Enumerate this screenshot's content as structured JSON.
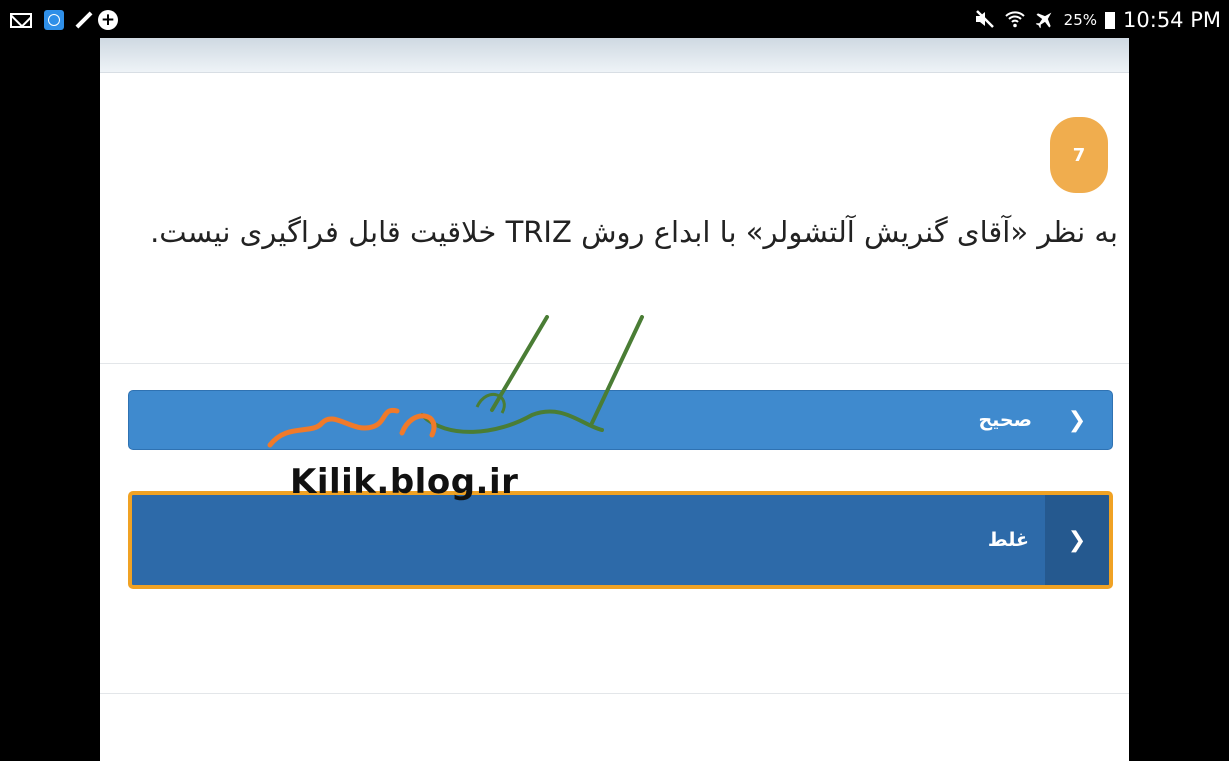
{
  "status_bar": {
    "left_icons": [
      "mail-icon",
      "app-icon",
      "pen-icon",
      "plus-icon"
    ],
    "right_icons": [
      "mute-icon",
      "wifi-icon",
      "airplane-icon",
      "battery-icon"
    ],
    "battery": "25%",
    "time": "10:54 PM"
  },
  "question": {
    "number": "7",
    "text": "به نظر «آقای گنریش آلتشولر» با ابداع روش TRIZ خلاقیت قابل فراگیری نیست."
  },
  "options": [
    {
      "label": "صحیح",
      "icon": "chevron-left-icon",
      "selected": false
    },
    {
      "label": "غلط",
      "icon": "chevron-left-icon",
      "selected": true
    }
  ],
  "watermark": {
    "logo_text": "کیلیک مدرسه",
    "url": "Kilik.blog.ir"
  },
  "colors": {
    "badge": "#f0ad4e",
    "option_bg": "#3f8ace",
    "option_selected_bg": "#2d6aa9",
    "selected_border": "#f0a224"
  }
}
